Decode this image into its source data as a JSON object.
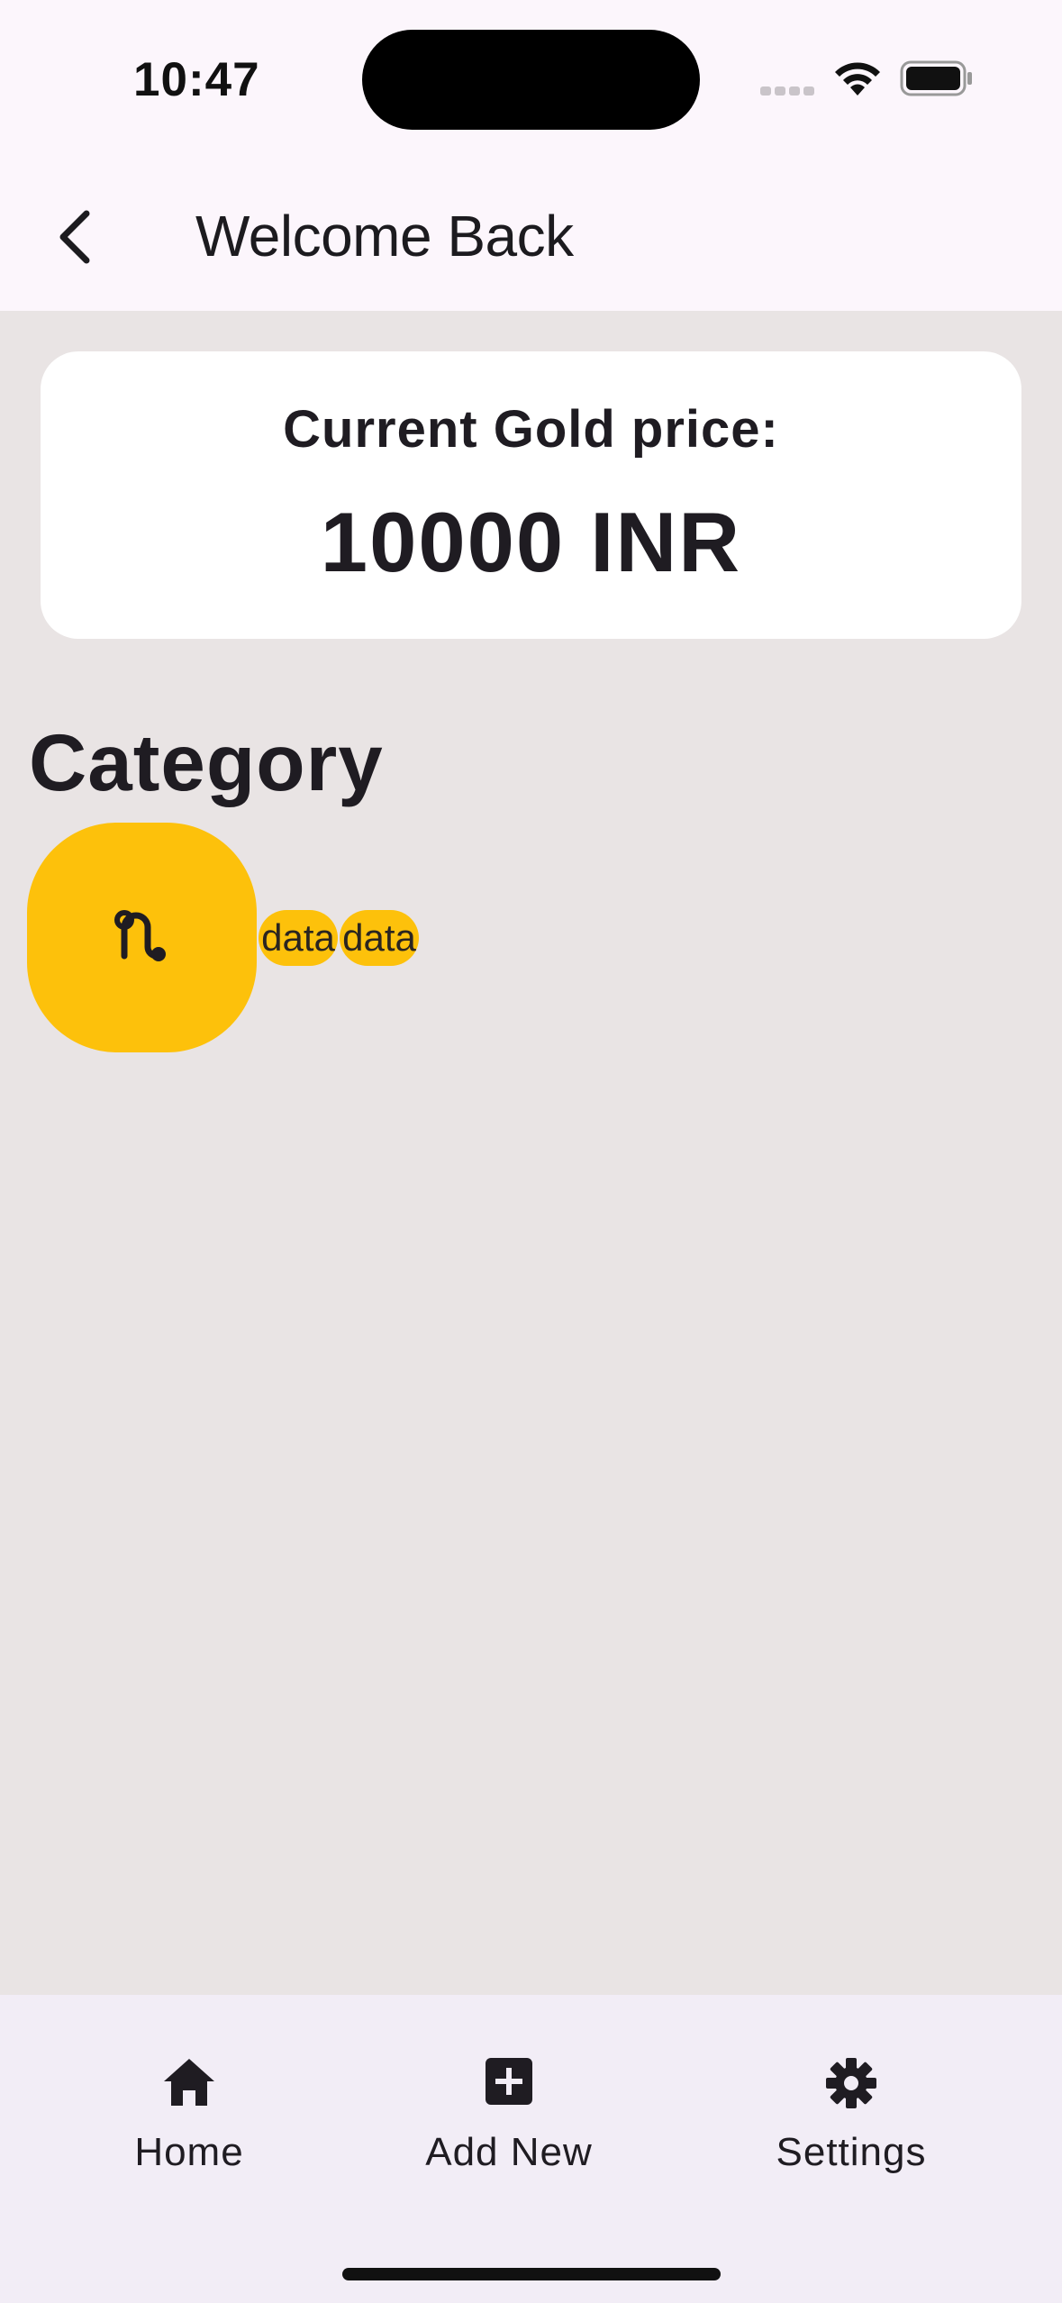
{
  "status_bar": {
    "time": "10:47"
  },
  "app_bar": {
    "title": "Welcome Back",
    "back_icon": "chevron-left-icon"
  },
  "price_card": {
    "label": "Current Gold price:",
    "value": "10000 INR"
  },
  "category": {
    "heading": "Category",
    "tile_icon": "route-icon",
    "chips": [
      "data",
      "data"
    ]
  },
  "bottom_nav": {
    "items": [
      {
        "label": "Home",
        "icon": "home-icon"
      },
      {
        "label": "Add New",
        "icon": "add-box-icon"
      },
      {
        "label": "Settings",
        "icon": "gear-icon"
      }
    ]
  },
  "colors": {
    "background": "#e9e4e4",
    "app_bar": "#fcf6fc",
    "card": "#ffffff",
    "accent": "#fdc10b",
    "bottom_nav": "#f2edf6",
    "text": "#1f1c22"
  }
}
